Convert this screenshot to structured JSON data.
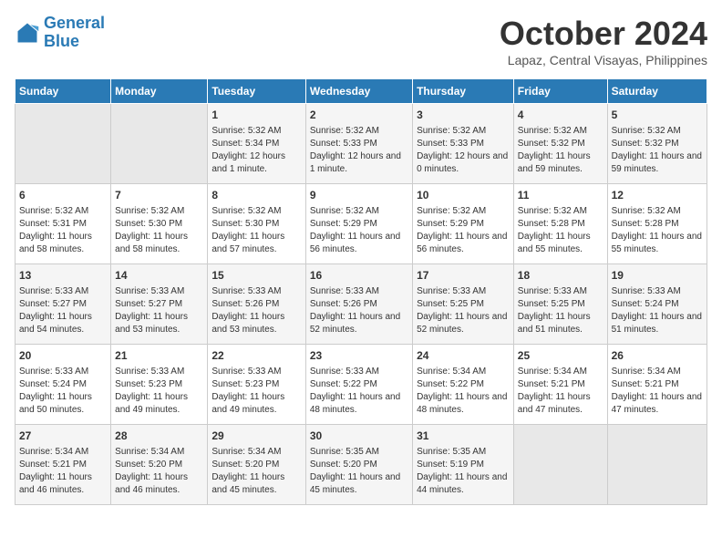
{
  "header": {
    "logo_line1": "General",
    "logo_line2": "Blue",
    "month": "October 2024",
    "location": "Lapaz, Central Visayas, Philippines"
  },
  "weekdays": [
    "Sunday",
    "Monday",
    "Tuesday",
    "Wednesday",
    "Thursday",
    "Friday",
    "Saturday"
  ],
  "weeks": [
    [
      {
        "day": "",
        "empty": true
      },
      {
        "day": "",
        "empty": true
      },
      {
        "day": "1",
        "sunrise": "5:32 AM",
        "sunset": "5:34 PM",
        "daylight": "12 hours and 1 minute."
      },
      {
        "day": "2",
        "sunrise": "5:32 AM",
        "sunset": "5:33 PM",
        "daylight": "12 hours and 1 minute."
      },
      {
        "day": "3",
        "sunrise": "5:32 AM",
        "sunset": "5:33 PM",
        "daylight": "12 hours and 0 minutes."
      },
      {
        "day": "4",
        "sunrise": "5:32 AM",
        "sunset": "5:32 PM",
        "daylight": "11 hours and 59 minutes."
      },
      {
        "day": "5",
        "sunrise": "5:32 AM",
        "sunset": "5:32 PM",
        "daylight": "11 hours and 59 minutes."
      }
    ],
    [
      {
        "day": "6",
        "sunrise": "5:32 AM",
        "sunset": "5:31 PM",
        "daylight": "11 hours and 58 minutes."
      },
      {
        "day": "7",
        "sunrise": "5:32 AM",
        "sunset": "5:30 PM",
        "daylight": "11 hours and 58 minutes."
      },
      {
        "day": "8",
        "sunrise": "5:32 AM",
        "sunset": "5:30 PM",
        "daylight": "11 hours and 57 minutes."
      },
      {
        "day": "9",
        "sunrise": "5:32 AM",
        "sunset": "5:29 PM",
        "daylight": "11 hours and 56 minutes."
      },
      {
        "day": "10",
        "sunrise": "5:32 AM",
        "sunset": "5:29 PM",
        "daylight": "11 hours and 56 minutes."
      },
      {
        "day": "11",
        "sunrise": "5:32 AM",
        "sunset": "5:28 PM",
        "daylight": "11 hours and 55 minutes."
      },
      {
        "day": "12",
        "sunrise": "5:32 AM",
        "sunset": "5:28 PM",
        "daylight": "11 hours and 55 minutes."
      }
    ],
    [
      {
        "day": "13",
        "sunrise": "5:33 AM",
        "sunset": "5:27 PM",
        "daylight": "11 hours and 54 minutes."
      },
      {
        "day": "14",
        "sunrise": "5:33 AM",
        "sunset": "5:27 PM",
        "daylight": "11 hours and 53 minutes."
      },
      {
        "day": "15",
        "sunrise": "5:33 AM",
        "sunset": "5:26 PM",
        "daylight": "11 hours and 53 minutes."
      },
      {
        "day": "16",
        "sunrise": "5:33 AM",
        "sunset": "5:26 PM",
        "daylight": "11 hours and 52 minutes."
      },
      {
        "day": "17",
        "sunrise": "5:33 AM",
        "sunset": "5:25 PM",
        "daylight": "11 hours and 52 minutes."
      },
      {
        "day": "18",
        "sunrise": "5:33 AM",
        "sunset": "5:25 PM",
        "daylight": "11 hours and 51 minutes."
      },
      {
        "day": "19",
        "sunrise": "5:33 AM",
        "sunset": "5:24 PM",
        "daylight": "11 hours and 51 minutes."
      }
    ],
    [
      {
        "day": "20",
        "sunrise": "5:33 AM",
        "sunset": "5:24 PM",
        "daylight": "11 hours and 50 minutes."
      },
      {
        "day": "21",
        "sunrise": "5:33 AM",
        "sunset": "5:23 PM",
        "daylight": "11 hours and 49 minutes."
      },
      {
        "day": "22",
        "sunrise": "5:33 AM",
        "sunset": "5:23 PM",
        "daylight": "11 hours and 49 minutes."
      },
      {
        "day": "23",
        "sunrise": "5:33 AM",
        "sunset": "5:22 PM",
        "daylight": "11 hours and 48 minutes."
      },
      {
        "day": "24",
        "sunrise": "5:34 AM",
        "sunset": "5:22 PM",
        "daylight": "11 hours and 48 minutes."
      },
      {
        "day": "25",
        "sunrise": "5:34 AM",
        "sunset": "5:21 PM",
        "daylight": "11 hours and 47 minutes."
      },
      {
        "day": "26",
        "sunrise": "5:34 AM",
        "sunset": "5:21 PM",
        "daylight": "11 hours and 47 minutes."
      }
    ],
    [
      {
        "day": "27",
        "sunrise": "5:34 AM",
        "sunset": "5:21 PM",
        "daylight": "11 hours and 46 minutes."
      },
      {
        "day": "28",
        "sunrise": "5:34 AM",
        "sunset": "5:20 PM",
        "daylight": "11 hours and 46 minutes."
      },
      {
        "day": "29",
        "sunrise": "5:34 AM",
        "sunset": "5:20 PM",
        "daylight": "11 hours and 45 minutes."
      },
      {
        "day": "30",
        "sunrise": "5:35 AM",
        "sunset": "5:20 PM",
        "daylight": "11 hours and 45 minutes."
      },
      {
        "day": "31",
        "sunrise": "5:35 AM",
        "sunset": "5:19 PM",
        "daylight": "11 hours and 44 minutes."
      },
      {
        "day": "",
        "empty": true
      },
      {
        "day": "",
        "empty": true
      }
    ]
  ],
  "labels": {
    "sunrise": "Sunrise:",
    "sunset": "Sunset:",
    "daylight": "Daylight:"
  }
}
